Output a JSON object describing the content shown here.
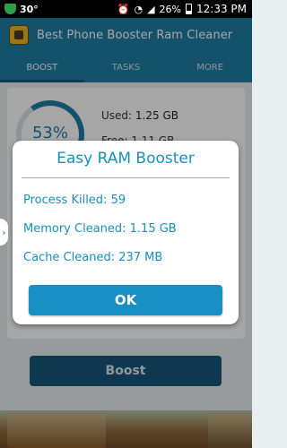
{
  "status_bar": {
    "temperature": "30°",
    "battery_percent": "26%",
    "time": "12:33 PM",
    "icons": [
      "shield-icon",
      "alarm-icon",
      "wifi-icon",
      "signal-icon",
      "battery-icon"
    ]
  },
  "app": {
    "title": "Best Phone Booster Ram Cleaner"
  },
  "tabs": [
    {
      "label": "BOOST",
      "active": true
    },
    {
      "label": "TASKS",
      "active": false
    },
    {
      "label": "MORE",
      "active": false
    }
  ],
  "memory": {
    "percent": "53%",
    "used_label": "Used:",
    "used_value": "1.25 GB",
    "free_label": "Free:",
    "free_value": "1.11 GB"
  },
  "boost_button_label": "Boost",
  "dialog": {
    "title": "Easy RAM Booster",
    "process_killed": "Process Killed: 59",
    "memory_cleaned": "Memory Cleaned: 1.15 GB",
    "cache_cleaned": "Cache Cleaned: 237 MB",
    "ok_label": "OK"
  },
  "colors": {
    "accent": "#1f7fa7",
    "dialog_text": "#1a8fb8",
    "ok_button": "#1a8fc4",
    "boost_button": "#16557c"
  }
}
